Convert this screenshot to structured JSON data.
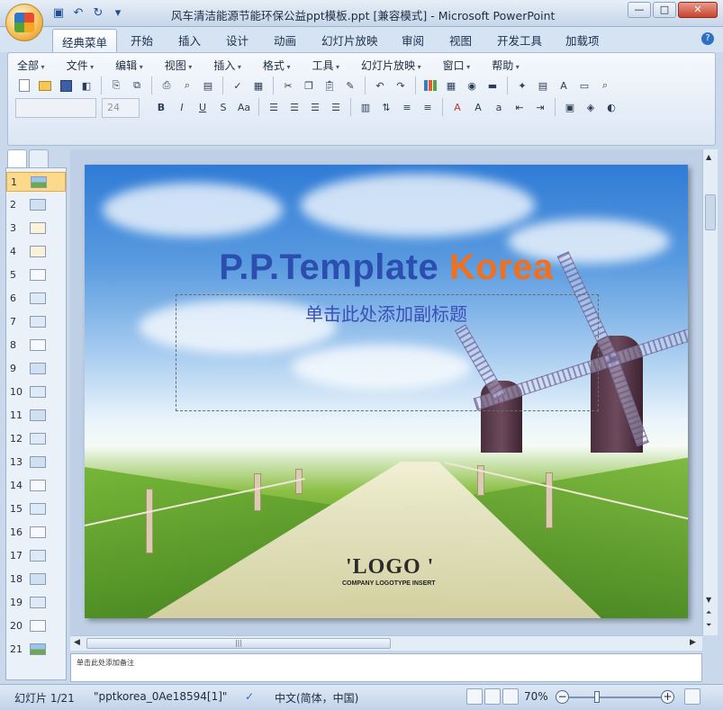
{
  "window": {
    "title": "风车清洁能源节能环保公益ppt模板.ppt [兼容模式] - Microsoft PowerPoint",
    "minimize": "—",
    "maximize": "□",
    "close": "✕"
  },
  "ribbon_tabs": [
    "经典菜单",
    "开始",
    "插入",
    "设计",
    "动画",
    "幻灯片放映",
    "审阅",
    "视图",
    "开发工具",
    "加载项"
  ],
  "menubar": [
    "全部",
    "文件",
    "编辑",
    "视图",
    "插入",
    "格式",
    "工具",
    "幻灯片放映",
    "窗口",
    "帮助"
  ],
  "font_size": "24",
  "thumbnails": [
    "1",
    "2",
    "3",
    "4",
    "5",
    "6",
    "7",
    "8",
    "9",
    "10",
    "11",
    "12",
    "13",
    "14",
    "15",
    "16",
    "17",
    "18",
    "19",
    "20",
    "21"
  ],
  "slide": {
    "title_part1": "P.P.Template",
    "title_part2": "Korea",
    "subtitle": "单击此处添加副标题",
    "logo": "'LOGO '",
    "logo_sub": "COMPANY LOGOTYPE INSERT"
  },
  "notes_placeholder": "单击此处添加备注",
  "status": {
    "slide_counter": "幻灯片 1/21",
    "theme": "\"pptkorea_0Ae18594[1]\"",
    "language": "中文(简体，中国)",
    "zoom": "70%"
  },
  "colors": {
    "title_blue": "#2c4faf",
    "title_orange": "#f0701e",
    "subtitle": "#3a4fb8"
  }
}
